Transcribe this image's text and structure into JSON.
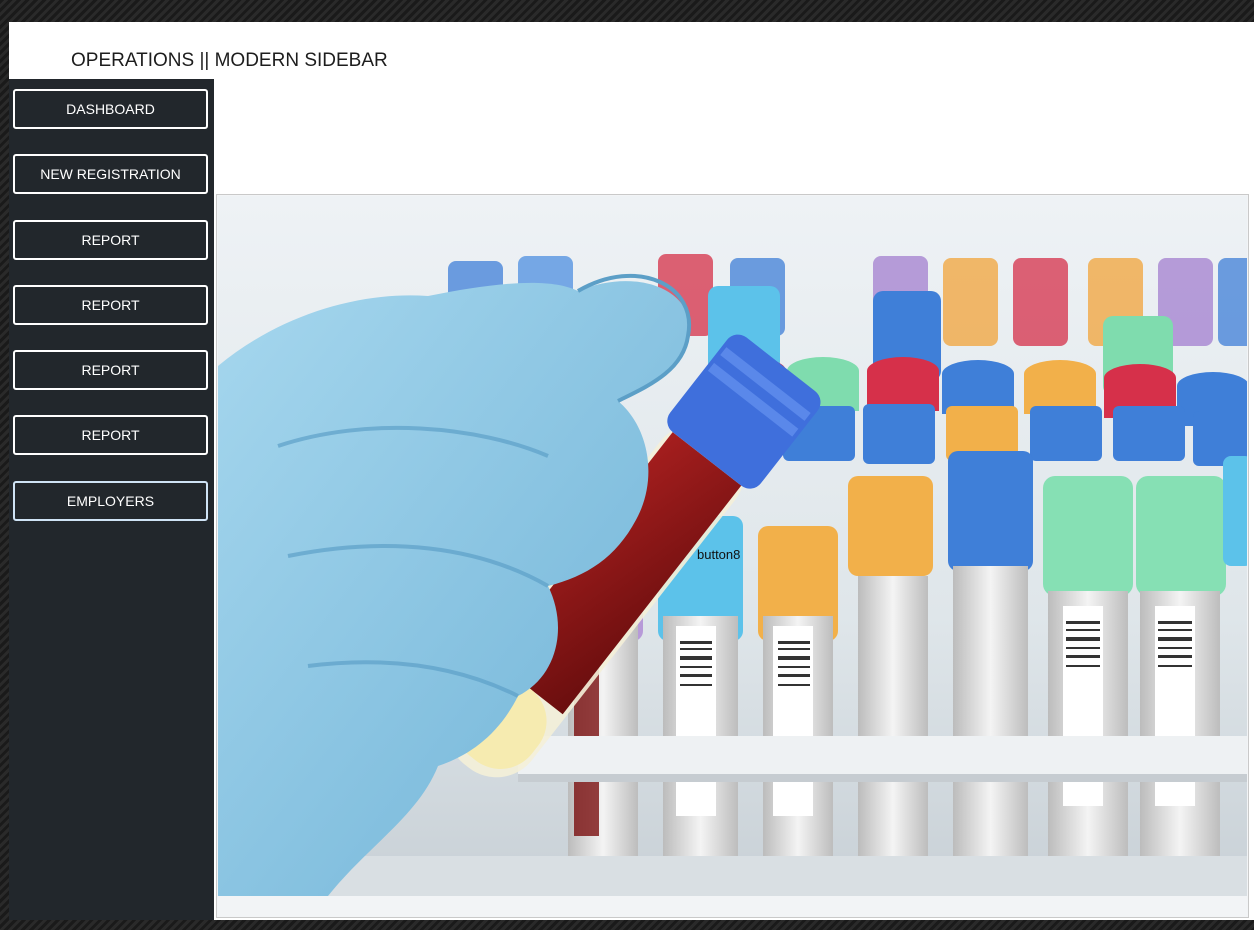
{
  "window": {
    "title": "OPERATIONS || MODERN SIDEBAR"
  },
  "sidebar": {
    "buttons": [
      {
        "label": "DASHBOARD"
      },
      {
        "label": "NEW REGISTRATION"
      },
      {
        "label": "REPORT"
      },
      {
        "label": "REPORT"
      },
      {
        "label": "REPORT"
      },
      {
        "label": "REPORT"
      },
      {
        "label": "EMPLOYERS"
      }
    ]
  },
  "main": {
    "overlay_button_label": "button8",
    "image_semantic": "blood-sample-tubes-photo"
  },
  "colors": {
    "sidebar_bg": "#22272c",
    "window_bg": "#ffffff",
    "glove": "#8cc6e4",
    "blood": "#8a1717"
  }
}
